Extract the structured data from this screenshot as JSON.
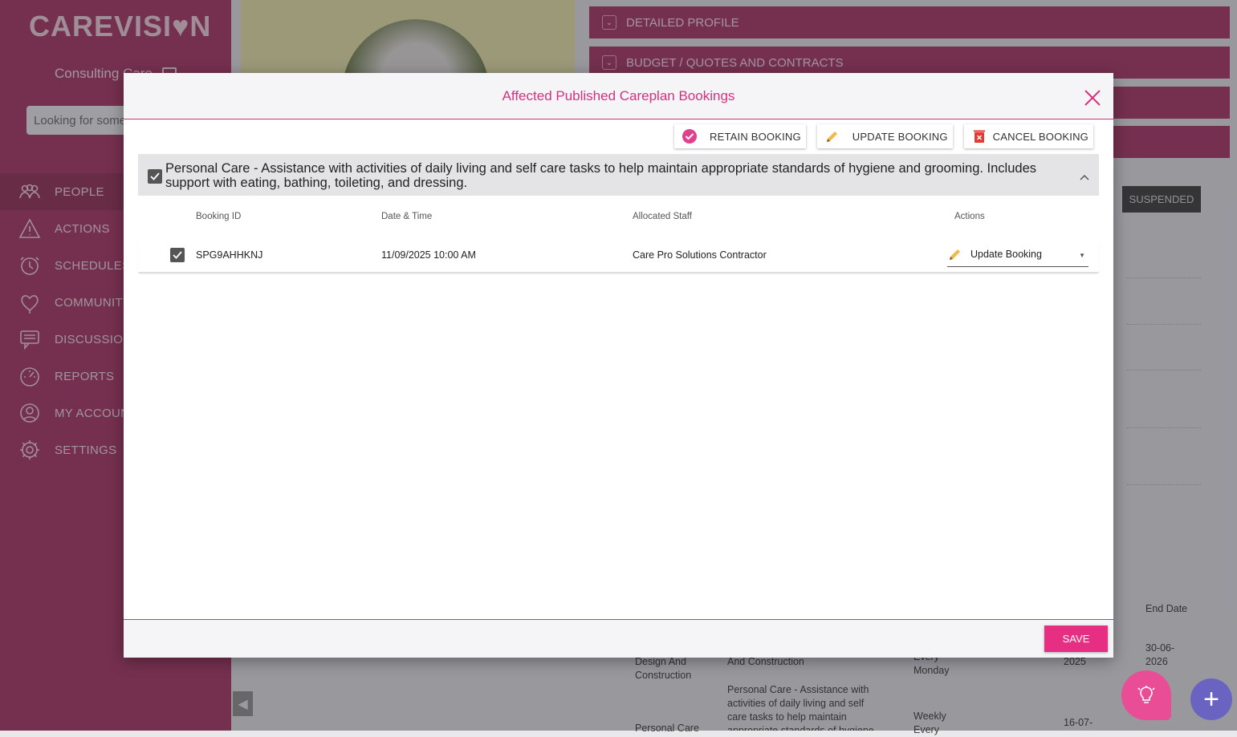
{
  "brand": {
    "logo": "CAREVISI♥N"
  },
  "sidebar": {
    "org_name": "Consulting Care",
    "search_placeholder": "Looking for some",
    "items": [
      {
        "label": "PEOPLE",
        "icon": "people-icon"
      },
      {
        "label": "ACTIONS",
        "icon": "warning-icon"
      },
      {
        "label": "SCHEDULES",
        "icon": "clock-icon"
      },
      {
        "label": "COMMUNITY",
        "icon": "heart-icon"
      },
      {
        "label": "DISCUSSION",
        "icon": "chat-icon"
      },
      {
        "label": "REPORTS",
        "icon": "gauge-icon"
      },
      {
        "label": "MY ACCOUNT",
        "icon": "user-icon"
      },
      {
        "label": "SETTINGS",
        "icon": "gear-icon"
      }
    ]
  },
  "background": {
    "accordions": [
      "DETAILED PROFILE",
      "BUDGET / QUOTES AND CONTRACTS"
    ],
    "status_badge": "SUSPENDED",
    "end_date_header": "End Date",
    "rows": [
      {
        "c1": "Design And Construction",
        "c2": "And Construction",
        "c3": "Every Monday",
        "c4": "2025",
        "c5": "30-06-2026"
      },
      {
        "c1": "Personal Care",
        "c2": "Personal Care - Assistance with activities of daily living and self care tasks to help maintain appropriate standards of hygiene",
        "c3": "Weekly Every",
        "c4": "16-07-",
        "c5": ""
      }
    ]
  },
  "modal": {
    "title": "Affected Published Careplan Bookings",
    "toolbar": {
      "retain": "RETAIN BOOKING",
      "update": "UPDATE BOOKING",
      "cancel": "CANCEL BOOKING"
    },
    "group_text": "Personal Care - Assistance with activities of daily living and self care tasks to help maintain appropriate standards of hygiene and grooming. Includes support with eating, bathing, toileting, and dressing.",
    "columns": [
      "Booking ID",
      "Date & Time",
      "Allocated Staff",
      "Actions"
    ],
    "bookings": [
      {
        "id": "SPG9AHHKNJ",
        "datetime": "11/09/2025 10:00 AM",
        "staff": "Care Pro Solutions Contractor",
        "action": "Update Booking"
      }
    ],
    "save_label": "SAVE"
  },
  "colors": {
    "brand": "#b1426e",
    "accent": "#e62f82",
    "title": "#d7307c"
  }
}
